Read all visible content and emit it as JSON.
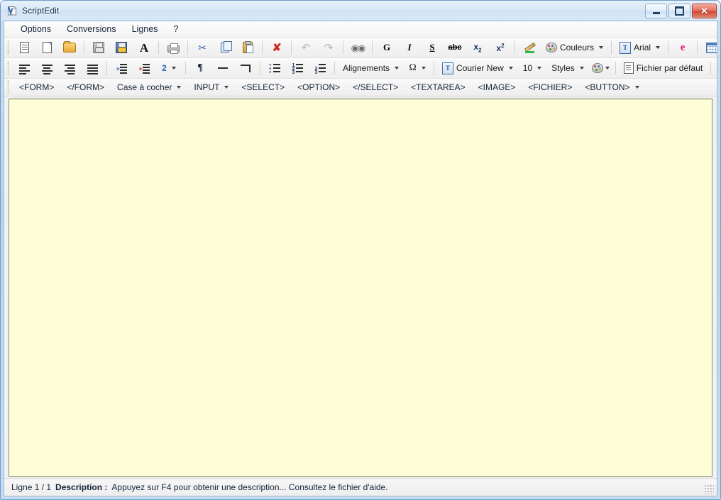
{
  "window": {
    "title": "ScriptEdit",
    "icon": "app-icon",
    "buttons": {
      "minimize": "minimize",
      "maximize": "maximize",
      "close": "close"
    }
  },
  "menubar": {
    "items": [
      {
        "label": "Options"
      },
      {
        "label": "Conversions"
      },
      {
        "label": "Lignes"
      },
      {
        "label": "?"
      }
    ]
  },
  "toolbar1": {
    "items": [
      {
        "name": "new-document-icon",
        "label": ""
      },
      {
        "name": "blank-page-icon",
        "label": ""
      },
      {
        "name": "open-folder-icon",
        "label": ""
      },
      {
        "name": "save-icon",
        "label": ""
      },
      {
        "name": "save-as-icon",
        "label": ""
      },
      {
        "name": "font-size-icon",
        "label": "A"
      },
      {
        "name": "print-icon",
        "label": ""
      },
      {
        "name": "cut-icon",
        "label": ""
      },
      {
        "name": "copy-icon",
        "label": ""
      },
      {
        "name": "paste-icon",
        "label": ""
      },
      {
        "name": "delete-icon",
        "label": ""
      },
      {
        "name": "undo-icon",
        "label": ""
      },
      {
        "name": "redo-icon",
        "label": ""
      },
      {
        "name": "find-icon",
        "label": ""
      },
      {
        "name": "bold-icon",
        "label": "G"
      },
      {
        "name": "italic-icon",
        "label": "I"
      },
      {
        "name": "underline-icon",
        "label": "S"
      },
      {
        "name": "strikethrough-icon",
        "label": "abc"
      },
      {
        "name": "subscript-icon",
        "label": "x"
      },
      {
        "name": "superscript-icon",
        "label": "x"
      },
      {
        "name": "highlight-icon",
        "label": ""
      },
      {
        "name": "colors-button",
        "label": "Couleurs"
      },
      {
        "name": "font-button",
        "label": "Arial"
      },
      {
        "name": "preview-browser-icon",
        "label": ""
      },
      {
        "name": "calendar-icon",
        "label": ""
      },
      {
        "name": "insert-image-icon",
        "label": ""
      },
      {
        "name": "insert-link-icon",
        "label": ""
      },
      {
        "name": "insert-table-icon",
        "label": ""
      },
      {
        "name": "insert-tag-icon",
        "label": ""
      },
      {
        "name": "home-tag-icon",
        "label": ""
      }
    ],
    "colors_label": "Couleurs",
    "font_label": "Arial"
  },
  "toolbar2": {
    "align_left": "align-left-icon",
    "align_center": "align-center-icon",
    "align_right": "align-right-icon",
    "align_justify": "align-justify-icon",
    "indent_increase": "indent-increase-icon",
    "indent_decrease": "indent-decrease-icon",
    "indent_value": "2",
    "paragraph_mark": "pilcrow-icon",
    "horizontal_rule": "horizontal-rule-icon",
    "line_break": "line-break-icon",
    "list_bullet": "bullet-list-icon",
    "list_number": "numbered-list-icon",
    "list_outline": "outline-list-icon",
    "alignments_label": "Alignements",
    "special_char": "omega-icon",
    "font_family_label": "Courier New",
    "font_size_label": "10",
    "styles_label": "Styles",
    "palette_icon": "palette-icon",
    "default_file_label": "Fichier par défaut",
    "color_sheet_icon": "color-sheet-icon",
    "boxed_a_icon": "boxed-a-icon",
    "brush_icon": "brush-icon"
  },
  "toolbar3": {
    "items": [
      {
        "label": "<FORM>",
        "dropdown": false
      },
      {
        "label": "</FORM>",
        "dropdown": false
      },
      {
        "label": "Case à cocher",
        "dropdown": true
      },
      {
        "label": "INPUT",
        "dropdown": true
      },
      {
        "label": "<SELECT>",
        "dropdown": false
      },
      {
        "label": "<OPTION>",
        "dropdown": false
      },
      {
        "label": "</SELECT>",
        "dropdown": false
      },
      {
        "label": "<TEXTAREA>",
        "dropdown": false
      },
      {
        "label": "<IMAGE>",
        "dropdown": false
      },
      {
        "label": "<FICHIER>",
        "dropdown": false
      },
      {
        "label": "<BUTTON>",
        "dropdown": true
      }
    ]
  },
  "editor": {
    "content": "",
    "background_color": "#fdfdd8"
  },
  "statusbar": {
    "line_info": "Ligne 1 / 1",
    "description_label": "Description :",
    "description_text": "Appuyez sur F4 pour obtenir une description... Consultez le fichier d'aide."
  },
  "colors": {
    "title_text": "#0b2a52",
    "editor_bg": "#fdfdd8",
    "frame": "#bcd4ec",
    "close_button": "#cf4530",
    "accent_bold": "#111111"
  }
}
